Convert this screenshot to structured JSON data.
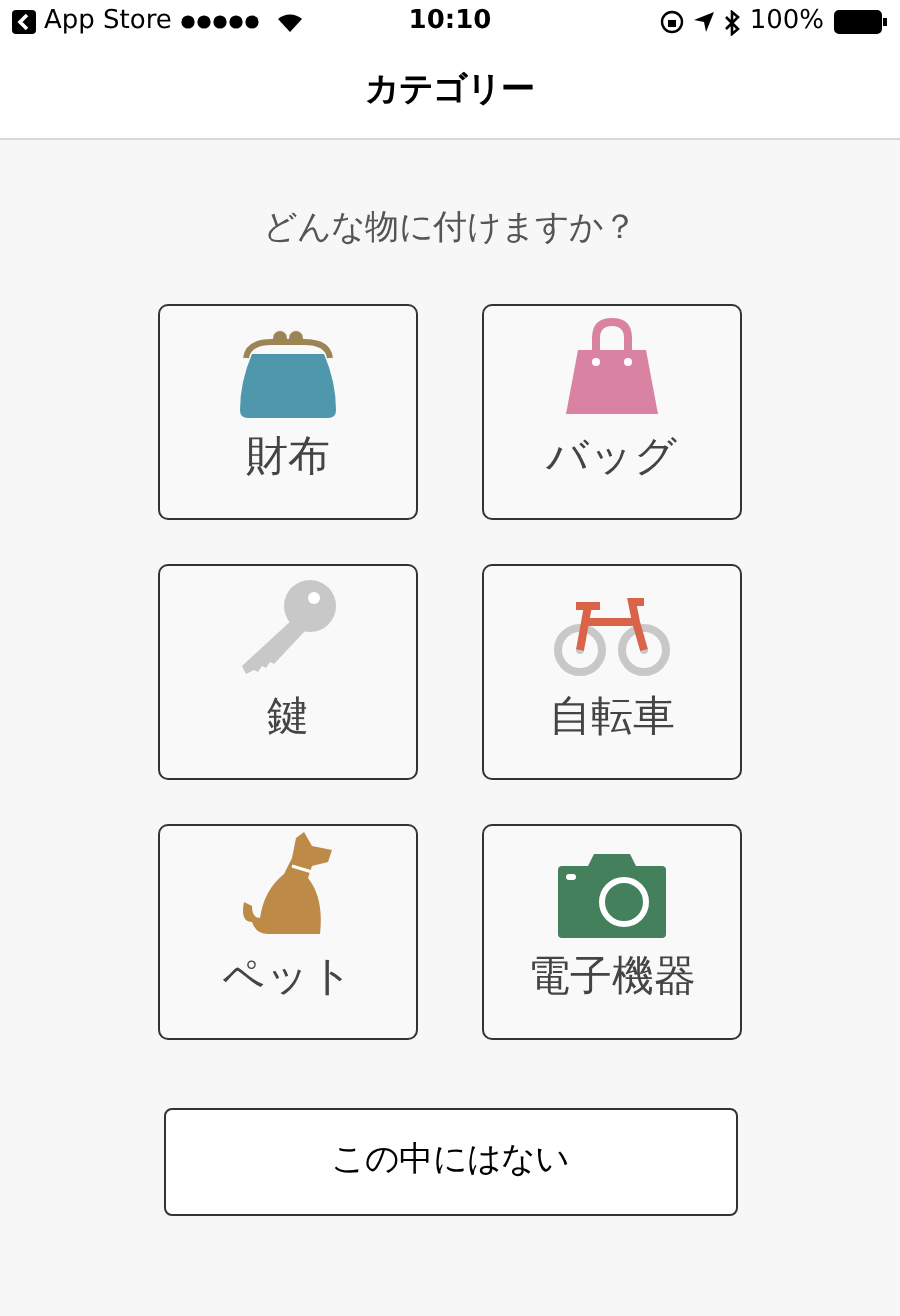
{
  "status_bar": {
    "back_label": "App Store",
    "time": "10:10",
    "battery": "100%"
  },
  "title": "カテゴリー",
  "question": "どんな物に付けますか？",
  "categories": [
    {
      "label": "財布",
      "kind": "purse"
    },
    {
      "label": "バッグ",
      "kind": "bag"
    },
    {
      "label": "鍵",
      "kind": "key"
    },
    {
      "label": "自転車",
      "kind": "bicycle"
    },
    {
      "label": "ペット",
      "kind": "dog"
    },
    {
      "label": "電子機器",
      "kind": "camera"
    }
  ],
  "none_button": "この中にはない"
}
